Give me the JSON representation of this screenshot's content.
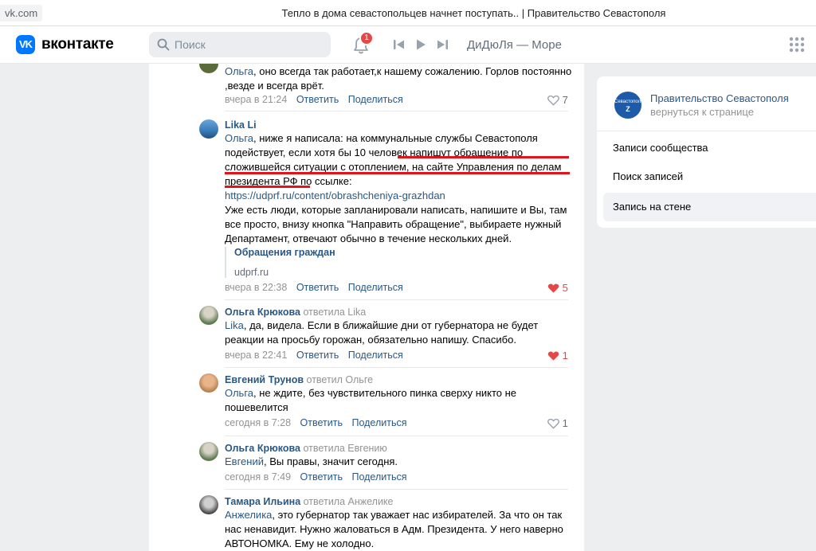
{
  "browser": {
    "url": "vk.com",
    "title": "Тепло в дома севастопольцев начнет поступать.. | Правительство Севастополя"
  },
  "header": {
    "logo_text": "VK",
    "wordmark": "вконтакте",
    "search_placeholder": "Поиск",
    "notifications_count": "1",
    "track": "ДиДюЛя — Море"
  },
  "comments": [
    {
      "text": [
        {
          "t": "Ольга",
          "mention": true
        },
        {
          "t": ", оно всегда так работает,к нашему сожалению. Горлов постоянно ,везде и всегда врёт."
        }
      ],
      "time": "вчера в 21:24",
      "reply_label": "Ответить",
      "share_label": "Поделиться",
      "likes": "7",
      "liked": false
    },
    {
      "author": "Lika Li",
      "reply_to": "",
      "text": [
        {
          "t": "Ольга",
          "mention": true
        },
        {
          "t": ", ниже я написала: на коммунальные службы Севастополя подействует, если хотя бы 10 человек напишут обращение по сложившейся ситуации с отоплением, на сайте Управления по делам президента РФ по ссылке:"
        }
      ],
      "link": "https://udprf.ru/content/obrashcheniya-grazhdan",
      "text2": "Уже есть люди, которые запланировали написать, напишите и Вы, там все просто, внизу кнопка \"Направить обращение\", выбираете нужный Департамент, отвечают обычно в течение нескольких дней.",
      "snippet_title": "Обращения граждан",
      "snippet_domain": "udprf.ru",
      "time": "вчера в 22:38",
      "reply_label": "Ответить",
      "share_label": "Поделиться",
      "likes": "5",
      "liked": true
    },
    {
      "author": "Ольга Крюкова",
      "reply_to": "ответила Lika",
      "text": [
        {
          "t": "Lika",
          "mention": true
        },
        {
          "t": ", да, видела. Если в ближайшие дни от губернатора не будет реакции на просьбу горожан, обязательно напишу. Спасибо."
        }
      ],
      "time": "вчера в 22:41",
      "reply_label": "Ответить",
      "share_label": "Поделиться",
      "likes": "1",
      "liked": true
    },
    {
      "author": "Евгений Трунов",
      "reply_to": "ответил Ольге",
      "text": [
        {
          "t": "Ольга",
          "mention": true
        },
        {
          "t": ", не ждите, без чувствительного пинка сверху никто не пошевелится"
        }
      ],
      "time": "сегодня в 7:28",
      "reply_label": "Ответить",
      "share_label": "Поделиться",
      "likes": "1",
      "liked": false
    },
    {
      "author": "Ольга Крюкова",
      "reply_to": "ответила Евгению",
      "text": [
        {
          "t": "Евгений",
          "mention": true
        },
        {
          "t": ", Вы правы, значит сегодня."
        }
      ],
      "time": "сегодня в 7:49",
      "reply_label": "Ответить",
      "share_label": "Поделиться",
      "likes": "",
      "liked": false
    },
    {
      "author": "Тамара Ильина",
      "reply_to": "ответила Анжелике",
      "text": [
        {
          "t": "Анжелика",
          "mention": true
        },
        {
          "t": ", это губернатор так уважает нас избирателей. За что он так нас ненавидит. Нужно жаловаться в Адм. Президента. У него наверно АВТОНОМКА. Ему не холодно."
        }
      ]
    }
  ],
  "sidebar": {
    "group_logo_text": "Севастополь",
    "group_logo_mark": "Z",
    "group_name": "Правительство Севастополя",
    "back_label": "вернуться к странице",
    "items": [
      {
        "label": "Записи сообщества",
        "active": false
      },
      {
        "label": "Поиск записей",
        "active": false
      },
      {
        "label": "Запись на стене",
        "active": true
      }
    ]
  },
  "colors": {
    "link": "#2a5885",
    "like_active": "#e64646",
    "annotation": "#e0141c",
    "brand": "#0077ff"
  }
}
